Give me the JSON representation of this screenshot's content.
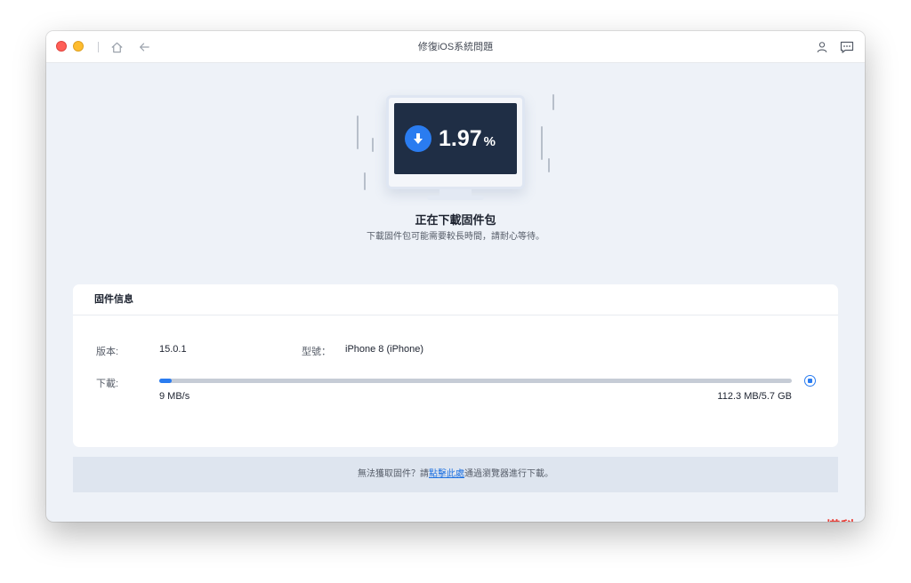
{
  "window": {
    "title": "修復iOS系統問題"
  },
  "hero": {
    "percent_value": "1.97",
    "percent_unit": "%",
    "progress_fraction": 0.0197,
    "title": "正在下載固件包",
    "subtitle": "下載固件包可能需要較長時間，請耐心等待。"
  },
  "firmware": {
    "card_title": "固件信息",
    "version_label": "版本:",
    "version_value": "15.0.1",
    "model_label": "型號：",
    "model_value": "iPhone 8 (iPhone)",
    "download_label": "下載:",
    "speed": "9 MB/s",
    "size_progress": "112.3 MB/5.7 GB"
  },
  "footer": {
    "text_before": "無法獲取固件？請",
    "link_text": "點擊此處",
    "text_after": "通過瀏覽器進行下載。"
  },
  "watermark": {
    "text": "塔科女子"
  },
  "colors": {
    "accent": "#2a7cf0",
    "screen": "#1f2e45",
    "window_bg": "#eef2f8"
  }
}
